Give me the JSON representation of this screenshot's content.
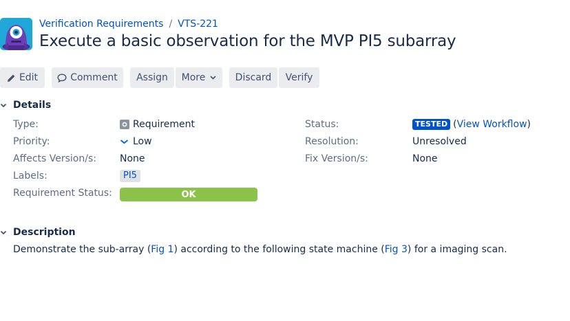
{
  "breadcrumb": {
    "project": "Verification Requirements",
    "separator": "/",
    "issue_key": "VTS-221"
  },
  "issue": {
    "title": "Execute a basic observation for the MVP PI5 subarray"
  },
  "toolbar": {
    "edit_label": "Edit",
    "comment_label": "Comment",
    "assign_label": "Assign",
    "more_label": "More",
    "discard_label": "Discard",
    "verify_label": "Verify"
  },
  "details": {
    "heading": "Details",
    "type": {
      "label": "Type:",
      "value": "Requirement"
    },
    "priority": {
      "label": "Priority:",
      "value": "Low"
    },
    "affects_version": {
      "label": "Affects Version/s:",
      "value": "None"
    },
    "labels": {
      "label": "Labels:",
      "value": "PI5"
    },
    "requirement_status": {
      "label": "Requirement Status:",
      "value": "OK",
      "color": "#8bc34a"
    },
    "status": {
      "label": "Status:",
      "value": "TESTED",
      "open_paren": "(",
      "workflow_link": "View Workflow",
      "close_paren": ")",
      "color": "#0052cc"
    },
    "resolution": {
      "label": "Resolution:",
      "value": "Unresolved"
    },
    "fix_version": {
      "label": "Fix Version/s:",
      "value": "None"
    }
  },
  "description": {
    "heading": "Description",
    "text_1": "Demonstrate the sub-array (",
    "link_1": "Fig 1",
    "text_2": ") according to the following state machine (",
    "link_2": "Fig 3",
    "text_3": ") for a imaging scan."
  },
  "icons": {
    "avatar": "purple-monster-avatar",
    "edit": "pencil-icon",
    "comment": "comment-icon",
    "more": "chevron-down-icon",
    "section_toggle": "chevron-down-icon",
    "type": "requirement-icon",
    "priority": "low-priority-chevron-icon"
  },
  "colors": {
    "link": "#0052cc",
    "button_bg": "#ebecf0",
    "avatar_bg": "#1fa7d8",
    "status_ok": "#8bc34a"
  }
}
